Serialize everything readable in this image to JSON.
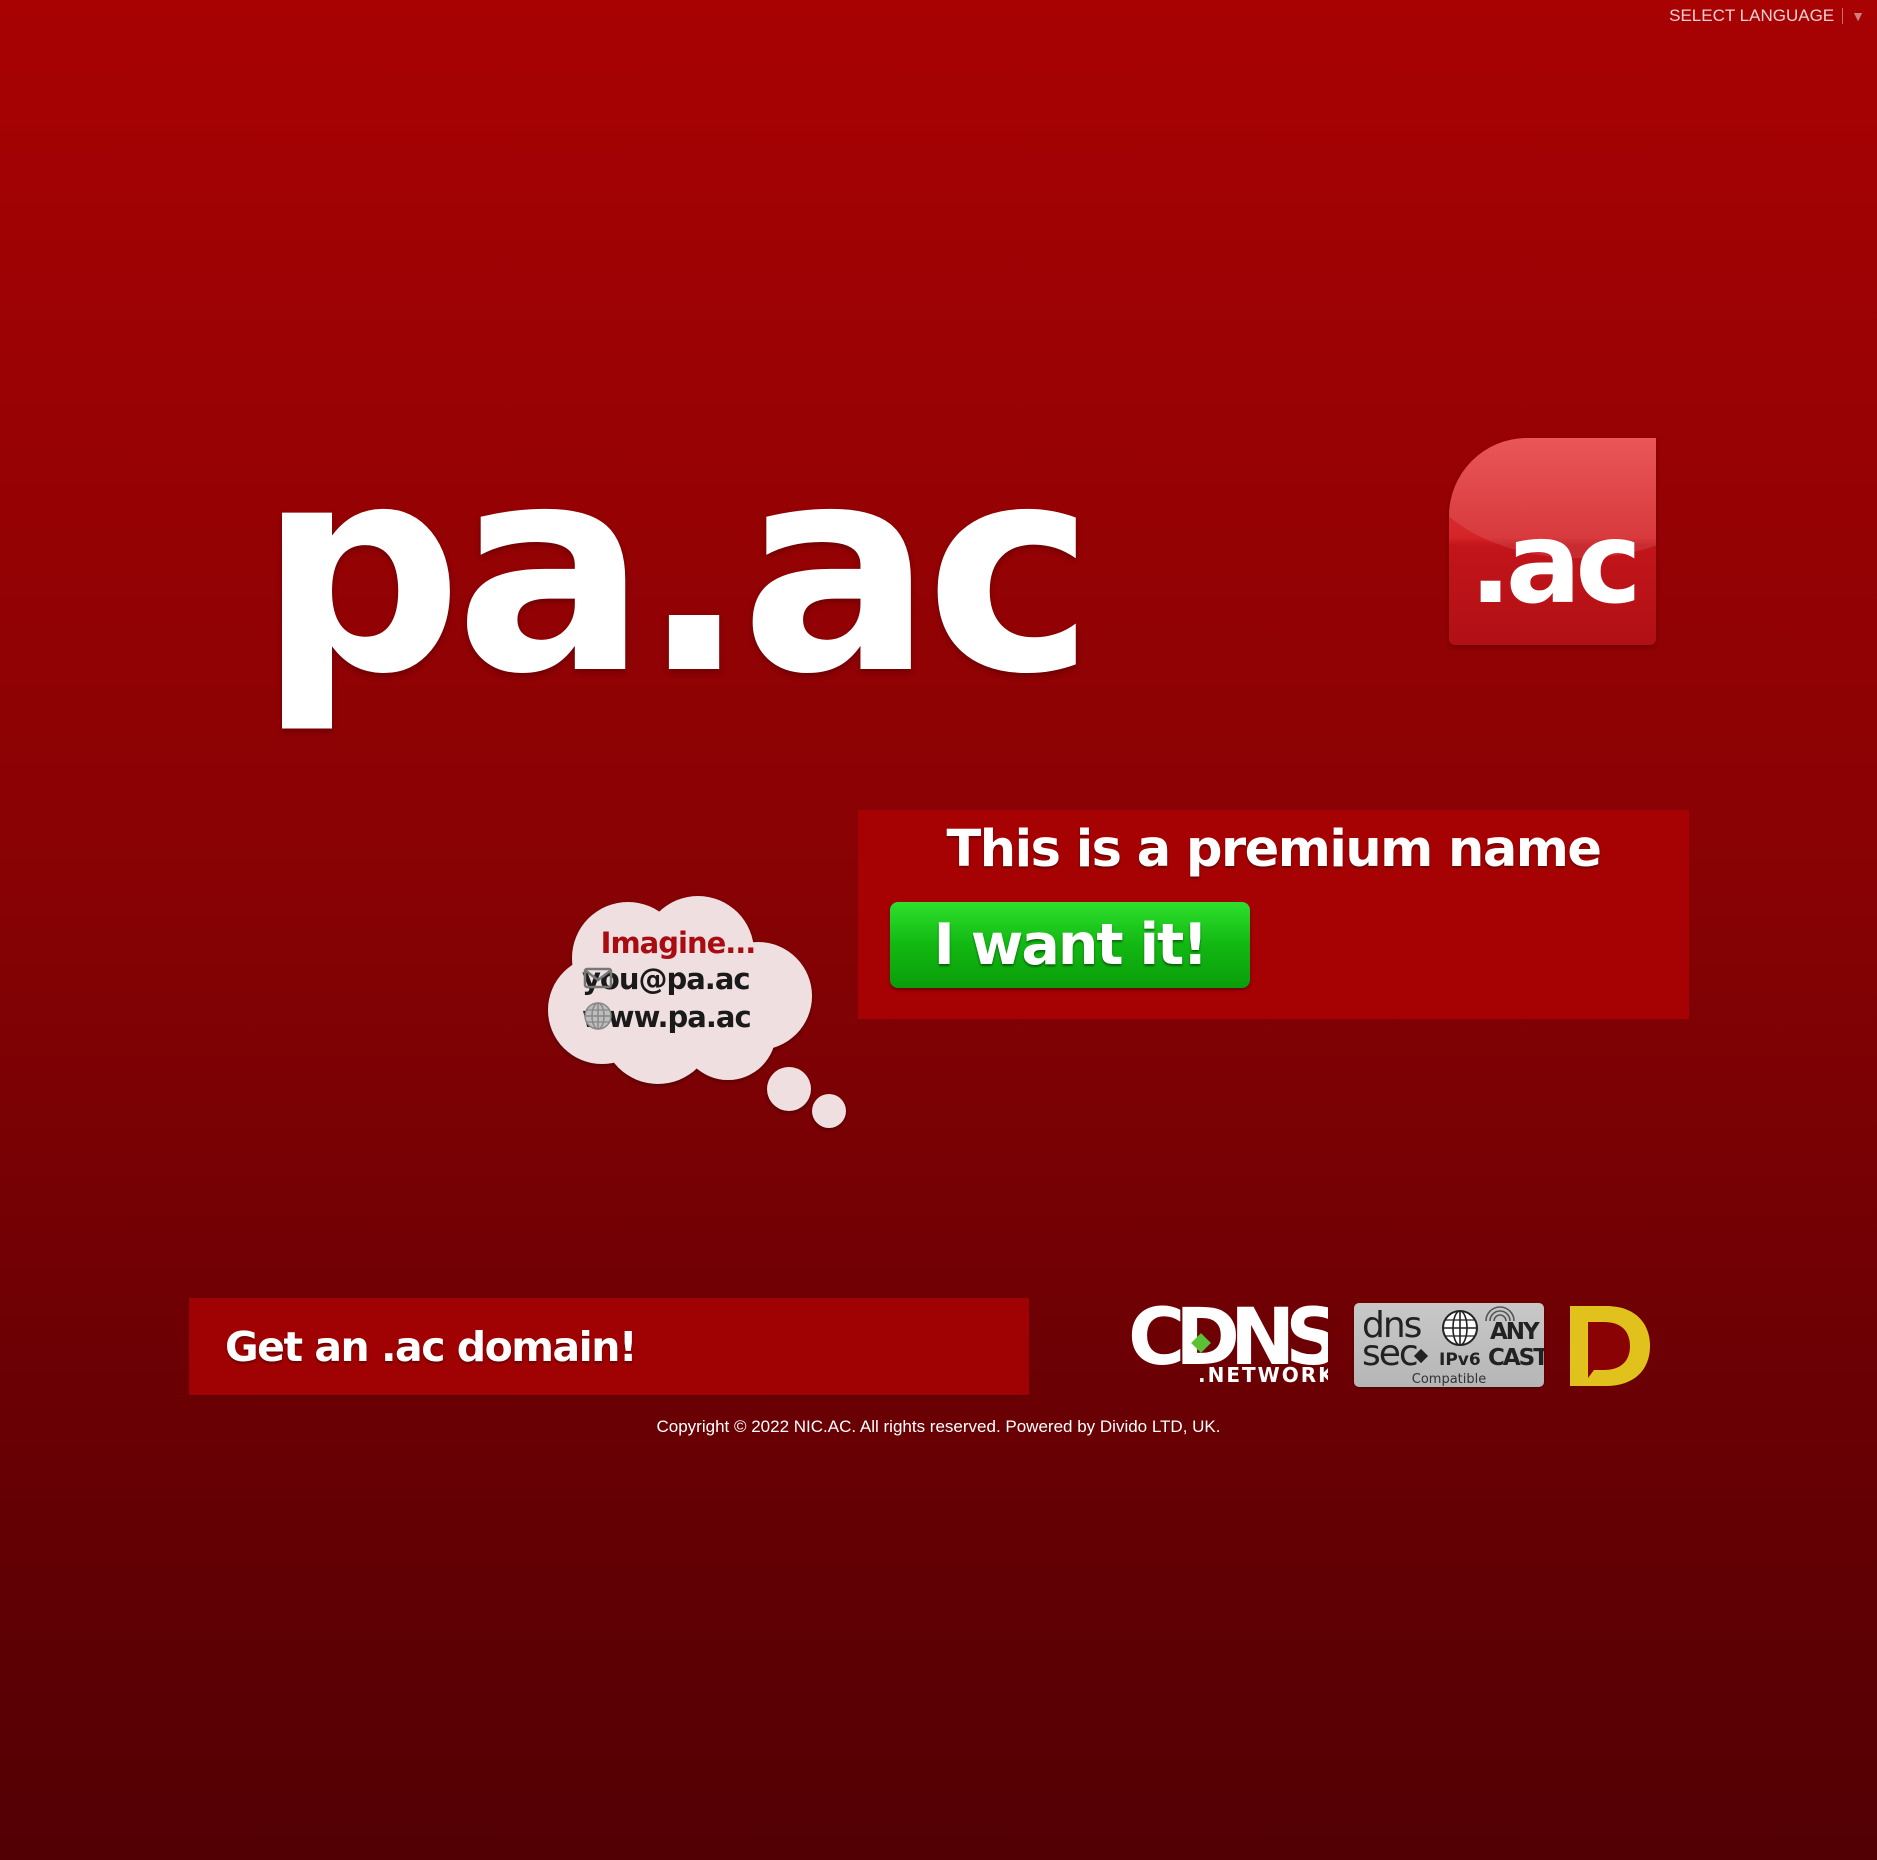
{
  "language_selector": {
    "label": "SELECT LANGUAGE",
    "arrow": "▼"
  },
  "domain": {
    "name": "pa.ac"
  },
  "tld_logo": {
    "text": ".ac"
  },
  "premium": {
    "title": "This is a premium name",
    "button_label": "I want it!"
  },
  "thought_cloud": {
    "heading": "Imagine...",
    "email": "you@pa.ac",
    "website": "www.pa.ac",
    "email_icon": "envelope-icon",
    "web_icon": "globe-icon"
  },
  "promo": {
    "label": "Get an .ac domain!"
  },
  "badges": {
    "cdns": {
      "main": "CDNS",
      "sub": ".NETWORK"
    },
    "dns": {
      "dns": "dns",
      "sec": "sec",
      "ipv6": "IPv6",
      "any": "ANY",
      "cast": "CAST",
      "compatible": "Compatible"
    }
  },
  "footer": {
    "copyright": "Copyright © 2022 NIC.AC. All rights reserved. Powered by Divido LTD, UK."
  },
  "colors": {
    "background_top": "#a80203",
    "background_bottom": "#520004",
    "panel_red": "#a60203",
    "button_green": "#12b812",
    "cloud_fill": "#efdfe0",
    "divido_yellow": "#e1c21c"
  }
}
